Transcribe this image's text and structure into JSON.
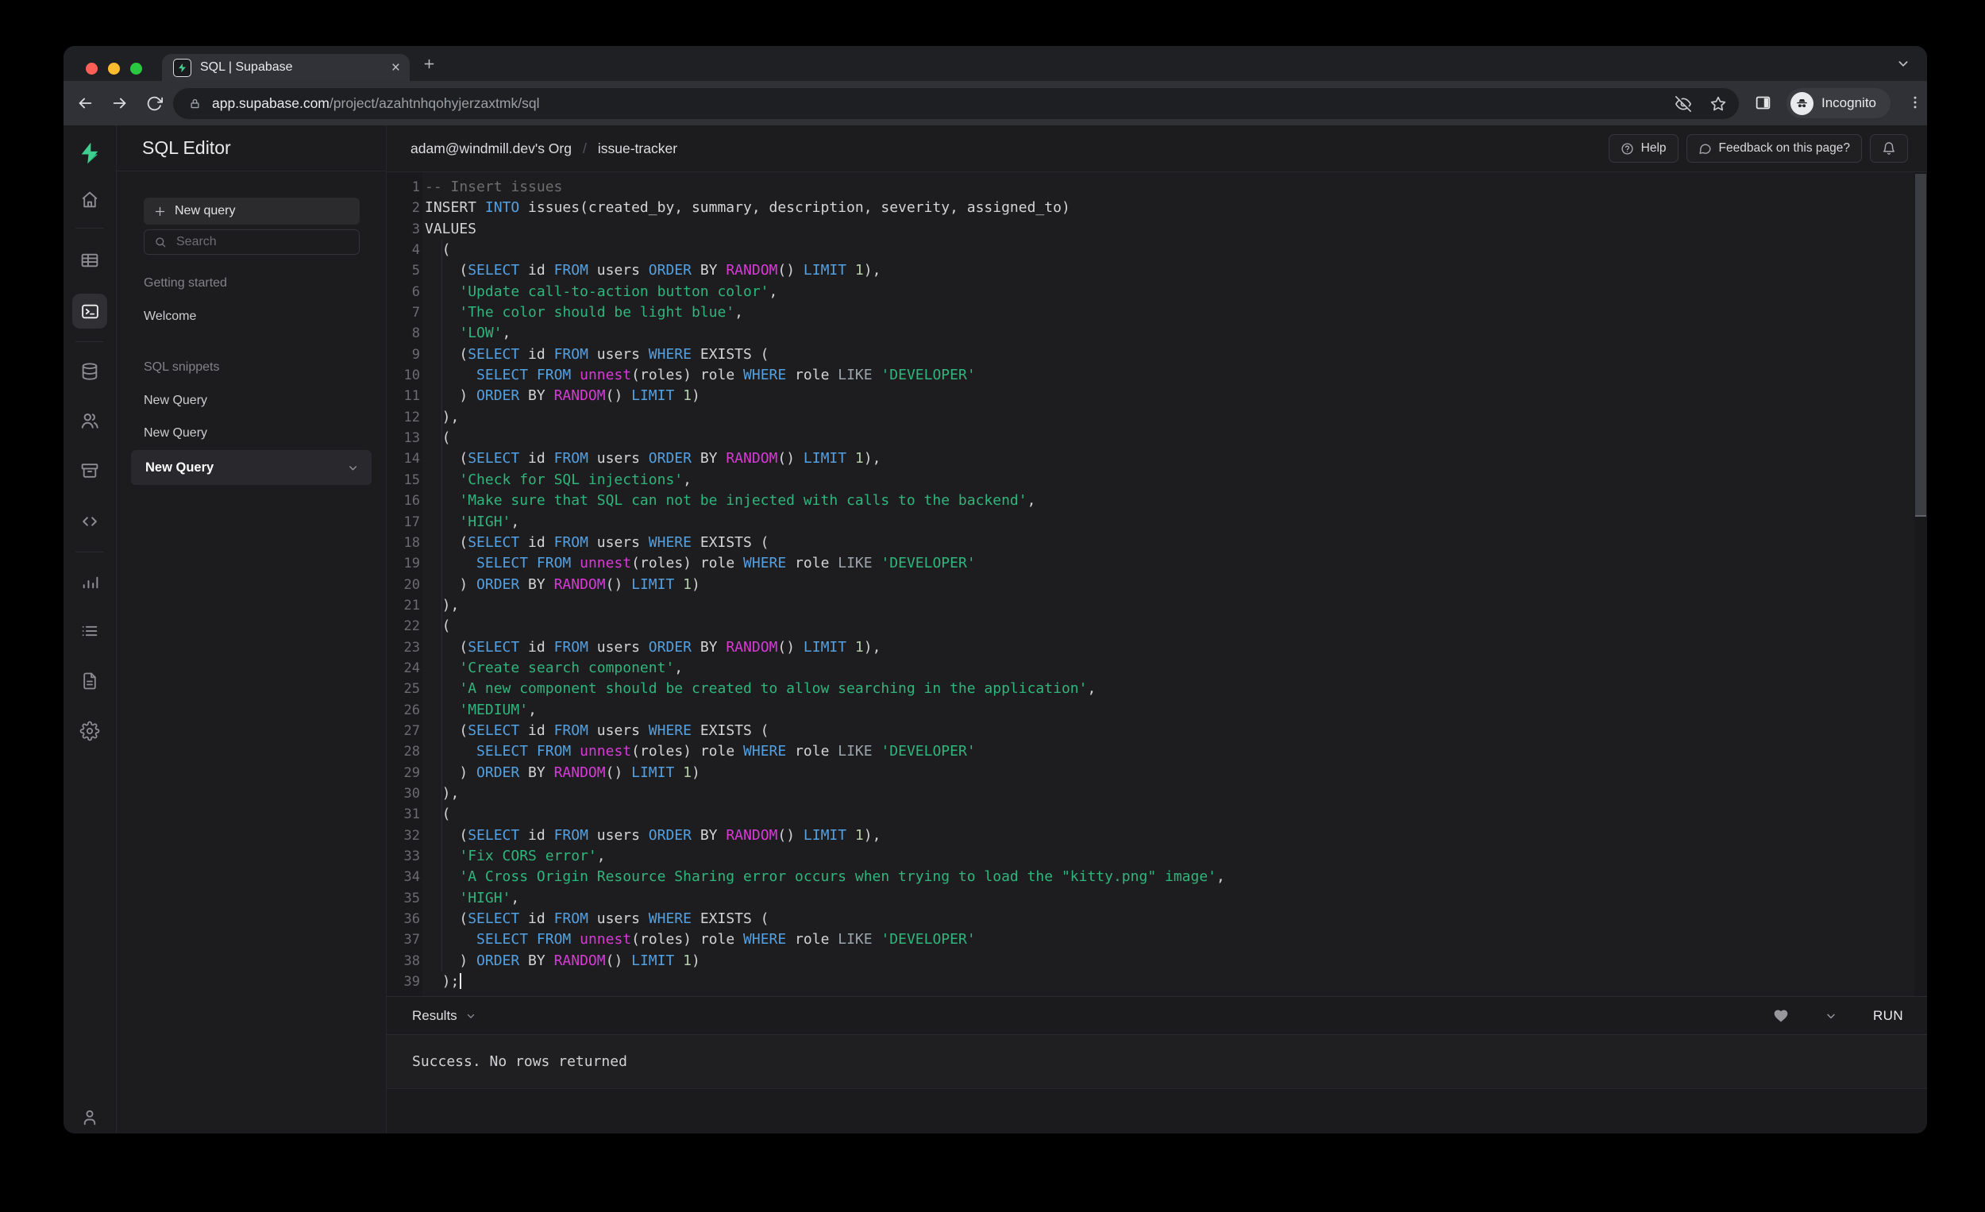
{
  "browser": {
    "tab_title": "SQL | Supabase",
    "url_domain": "app.supabase.com",
    "url_path": "/project/azahtnhqohyjerzaxtmk/sql",
    "incognito_label": "Incognito"
  },
  "header": {
    "title": "SQL Editor",
    "breadcrumb_org": "adam@windmill.dev's Org",
    "breadcrumb_sep": "/",
    "breadcrumb_project": "issue-tracker",
    "help_label": "Help",
    "feedback_label": "Feedback on this page?"
  },
  "sidebar": {
    "new_query_button": "New query",
    "search_placeholder": "Search",
    "getting_started_label": "Getting started",
    "welcome_item": "Welcome",
    "sql_snippets_label": "SQL snippets",
    "snippets": [
      "New Query",
      "New Query"
    ],
    "selected_snippet": "New Query"
  },
  "rail_icons": [
    "supabase-logo",
    "home",
    "table-editor",
    "sql-editor",
    "database",
    "auth-users",
    "storage",
    "edge-functions",
    "reports",
    "logs",
    "api-docs",
    "settings",
    "account"
  ],
  "colors": {
    "brand_green": "#3ECF8E",
    "keyword_blue": "#54A0E0",
    "string_green": "#30B57C",
    "function_magenta": "#D63BD6",
    "comment_gray": "#6D6D6D",
    "number_green": "#B5CEA8"
  },
  "results": {
    "tab_label": "Results",
    "run_label": "RUN",
    "message": "Success. No rows returned"
  },
  "editor": {
    "lines": [
      [
        [
          "c",
          "-- Insert issues"
        ]
      ],
      [
        [
          "w",
          "INSERT "
        ],
        [
          "k",
          "INTO"
        ],
        [
          "w",
          " issues(created_by, summary, description, severity, assigned_to)"
        ]
      ],
      [
        [
          "w",
          "VALUES"
        ]
      ],
      [
        [
          "w",
          "  ("
        ]
      ],
      [
        [
          "w",
          "    ("
        ],
        [
          "k",
          "SELECT"
        ],
        [
          "w",
          " id "
        ],
        [
          "k",
          "FROM"
        ],
        [
          "w",
          " users "
        ],
        [
          "k",
          "ORDER"
        ],
        [
          "w",
          " BY "
        ],
        [
          "f",
          "RANDOM"
        ],
        [
          "w",
          "() "
        ],
        [
          "k",
          "LIMIT"
        ],
        [
          "w",
          " "
        ],
        [
          "n",
          "1"
        ],
        [
          "w",
          "),"
        ]
      ],
      [
        [
          "w",
          "    "
        ],
        [
          "s",
          "'Update call-to-action button color'"
        ],
        [
          "w",
          ","
        ]
      ],
      [
        [
          "w",
          "    "
        ],
        [
          "s",
          "'The color should be light blue'"
        ],
        [
          "w",
          ","
        ]
      ],
      [
        [
          "w",
          "    "
        ],
        [
          "s",
          "'LOW'"
        ],
        [
          "w",
          ","
        ]
      ],
      [
        [
          "w",
          "    ("
        ],
        [
          "k",
          "SELECT"
        ],
        [
          "w",
          " id "
        ],
        [
          "k",
          "FROM"
        ],
        [
          "w",
          " users "
        ],
        [
          "k",
          "WHERE"
        ],
        [
          "w",
          " EXISTS ("
        ]
      ],
      [
        [
          "w",
          "      "
        ],
        [
          "k",
          "SELECT"
        ],
        [
          "w",
          " "
        ],
        [
          "k",
          "FROM"
        ],
        [
          "w",
          " "
        ],
        [
          "f",
          "unnest"
        ],
        [
          "w",
          "(roles) role "
        ],
        [
          "k",
          "WHERE"
        ],
        [
          "w",
          " role "
        ],
        [
          "g",
          "LIKE"
        ],
        [
          "w",
          " "
        ],
        [
          "s",
          "'DEVELOPER'"
        ]
      ],
      [
        [
          "w",
          "    ) "
        ],
        [
          "k",
          "ORDER"
        ],
        [
          "w",
          " BY "
        ],
        [
          "f",
          "RANDOM"
        ],
        [
          "w",
          "() "
        ],
        [
          "k",
          "LIMIT"
        ],
        [
          "w",
          " "
        ],
        [
          "n",
          "1"
        ],
        [
          "w",
          ")"
        ]
      ],
      [
        [
          "w",
          "  ),"
        ]
      ],
      [
        [
          "w",
          "  ("
        ]
      ],
      [
        [
          "w",
          "    ("
        ],
        [
          "k",
          "SELECT"
        ],
        [
          "w",
          " id "
        ],
        [
          "k",
          "FROM"
        ],
        [
          "w",
          " users "
        ],
        [
          "k",
          "ORDER"
        ],
        [
          "w",
          " BY "
        ],
        [
          "f",
          "RANDOM"
        ],
        [
          "w",
          "() "
        ],
        [
          "k",
          "LIMIT"
        ],
        [
          "w",
          " "
        ],
        [
          "n",
          "1"
        ],
        [
          "w",
          "),"
        ]
      ],
      [
        [
          "w",
          "    "
        ],
        [
          "s",
          "'Check for SQL injections'"
        ],
        [
          "w",
          ","
        ]
      ],
      [
        [
          "w",
          "    "
        ],
        [
          "s",
          "'Make sure that SQL can not be injected with calls to the backend'"
        ],
        [
          "w",
          ","
        ]
      ],
      [
        [
          "w",
          "    "
        ],
        [
          "s",
          "'HIGH'"
        ],
        [
          "w",
          ","
        ]
      ],
      [
        [
          "w",
          "    ("
        ],
        [
          "k",
          "SELECT"
        ],
        [
          "w",
          " id "
        ],
        [
          "k",
          "FROM"
        ],
        [
          "w",
          " users "
        ],
        [
          "k",
          "WHERE"
        ],
        [
          "w",
          " EXISTS ("
        ]
      ],
      [
        [
          "w",
          "      "
        ],
        [
          "k",
          "SELECT"
        ],
        [
          "w",
          " "
        ],
        [
          "k",
          "FROM"
        ],
        [
          "w",
          " "
        ],
        [
          "f",
          "unnest"
        ],
        [
          "w",
          "(roles) role "
        ],
        [
          "k",
          "WHERE"
        ],
        [
          "w",
          " role "
        ],
        [
          "g",
          "LIKE"
        ],
        [
          "w",
          " "
        ],
        [
          "s",
          "'DEVELOPER'"
        ]
      ],
      [
        [
          "w",
          "    ) "
        ],
        [
          "k",
          "ORDER"
        ],
        [
          "w",
          " BY "
        ],
        [
          "f",
          "RANDOM"
        ],
        [
          "w",
          "() "
        ],
        [
          "k",
          "LIMIT"
        ],
        [
          "w",
          " "
        ],
        [
          "n",
          "1"
        ],
        [
          "w",
          ")"
        ]
      ],
      [
        [
          "w",
          "  ),"
        ]
      ],
      [
        [
          "w",
          "  ("
        ]
      ],
      [
        [
          "w",
          "    ("
        ],
        [
          "k",
          "SELECT"
        ],
        [
          "w",
          " id "
        ],
        [
          "k",
          "FROM"
        ],
        [
          "w",
          " users "
        ],
        [
          "k",
          "ORDER"
        ],
        [
          "w",
          " BY "
        ],
        [
          "f",
          "RANDOM"
        ],
        [
          "w",
          "() "
        ],
        [
          "k",
          "LIMIT"
        ],
        [
          "w",
          " "
        ],
        [
          "n",
          "1"
        ],
        [
          "w",
          "),"
        ]
      ],
      [
        [
          "w",
          "    "
        ],
        [
          "s",
          "'Create search component'"
        ],
        [
          "w",
          ","
        ]
      ],
      [
        [
          "w",
          "    "
        ],
        [
          "s",
          "'A new component should be created to allow searching in the application'"
        ],
        [
          "w",
          ","
        ]
      ],
      [
        [
          "w",
          "    "
        ],
        [
          "s",
          "'MEDIUM'"
        ],
        [
          "w",
          ","
        ]
      ],
      [
        [
          "w",
          "    ("
        ],
        [
          "k",
          "SELECT"
        ],
        [
          "w",
          " id "
        ],
        [
          "k",
          "FROM"
        ],
        [
          "w",
          " users "
        ],
        [
          "k",
          "WHERE"
        ],
        [
          "w",
          " EXISTS ("
        ]
      ],
      [
        [
          "w",
          "      "
        ],
        [
          "k",
          "SELECT"
        ],
        [
          "w",
          " "
        ],
        [
          "k",
          "FROM"
        ],
        [
          "w",
          " "
        ],
        [
          "f",
          "unnest"
        ],
        [
          "w",
          "(roles) role "
        ],
        [
          "k",
          "WHERE"
        ],
        [
          "w",
          " role "
        ],
        [
          "g",
          "LIKE"
        ],
        [
          "w",
          " "
        ],
        [
          "s",
          "'DEVELOPER'"
        ]
      ],
      [
        [
          "w",
          "    ) "
        ],
        [
          "k",
          "ORDER"
        ],
        [
          "w",
          " BY "
        ],
        [
          "f",
          "RANDOM"
        ],
        [
          "w",
          "() "
        ],
        [
          "k",
          "LIMIT"
        ],
        [
          "w",
          " "
        ],
        [
          "n",
          "1"
        ],
        [
          "w",
          ")"
        ]
      ],
      [
        [
          "w",
          "  ),"
        ]
      ],
      [
        [
          "w",
          "  ("
        ]
      ],
      [
        [
          "w",
          "    ("
        ],
        [
          "k",
          "SELECT"
        ],
        [
          "w",
          " id "
        ],
        [
          "k",
          "FROM"
        ],
        [
          "w",
          " users "
        ],
        [
          "k",
          "ORDER"
        ],
        [
          "w",
          " BY "
        ],
        [
          "f",
          "RANDOM"
        ],
        [
          "w",
          "() "
        ],
        [
          "k",
          "LIMIT"
        ],
        [
          "w",
          " "
        ],
        [
          "n",
          "1"
        ],
        [
          "w",
          "),"
        ]
      ],
      [
        [
          "w",
          "    "
        ],
        [
          "s",
          "'Fix CORS error'"
        ],
        [
          "w",
          ","
        ]
      ],
      [
        [
          "w",
          "    "
        ],
        [
          "s",
          "'A Cross Origin Resource Sharing error occurs when trying to load the \"kitty.png\" image'"
        ],
        [
          "w",
          ","
        ]
      ],
      [
        [
          "w",
          "    "
        ],
        [
          "s",
          "'HIGH'"
        ],
        [
          "w",
          ","
        ]
      ],
      [
        [
          "w",
          "    ("
        ],
        [
          "k",
          "SELECT"
        ],
        [
          "w",
          " id "
        ],
        [
          "k",
          "FROM"
        ],
        [
          "w",
          " users "
        ],
        [
          "k",
          "WHERE"
        ],
        [
          "w",
          " EXISTS ("
        ]
      ],
      [
        [
          "w",
          "      "
        ],
        [
          "k",
          "SELECT"
        ],
        [
          "w",
          " "
        ],
        [
          "k",
          "FROM"
        ],
        [
          "w",
          " "
        ],
        [
          "f",
          "unnest"
        ],
        [
          "w",
          "(roles) role "
        ],
        [
          "k",
          "WHERE"
        ],
        [
          "w",
          " role "
        ],
        [
          "g",
          "LIKE"
        ],
        [
          "w",
          " "
        ],
        [
          "s",
          "'DEVELOPER'"
        ]
      ],
      [
        [
          "w",
          "    ) "
        ],
        [
          "k",
          "ORDER"
        ],
        [
          "w",
          " BY "
        ],
        [
          "f",
          "RANDOM"
        ],
        [
          "w",
          "() "
        ],
        [
          "k",
          "LIMIT"
        ],
        [
          "w",
          " "
        ],
        [
          "n",
          "1"
        ],
        [
          "w",
          ")"
        ]
      ],
      [
        [
          "w",
          "  );"
        ],
        [
          "cursor",
          ""
        ]
      ]
    ]
  }
}
